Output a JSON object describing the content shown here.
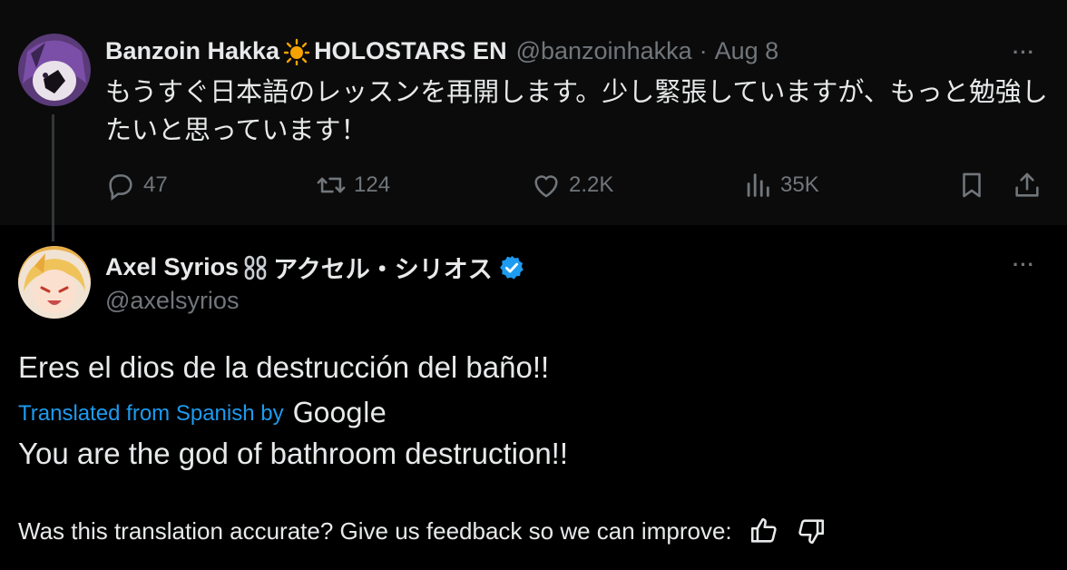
{
  "parent_tweet": {
    "author_name": "Banzoin Hakka",
    "name_emoji": "☀",
    "org": "HOLOSTARS EN",
    "handle": "@banzoinhakka",
    "separator": "·",
    "date": "Aug 8",
    "more_label": "···",
    "text": "もうすぐ日本語のレッスンを再開します。少し緊張していますが、もっと勉強したいと思っています！",
    "replies": "47",
    "reposts": "124",
    "likes": "2.2K",
    "views": "35K"
  },
  "reply_tweet": {
    "author_name": "Axel Syrios",
    "name_emoji": "⛓",
    "name_jp": "アクセル・シリオス",
    "handle": "@axelsyrios",
    "more_label": "···",
    "original_text": "Eres el dios de la destrucción del baño!!",
    "translated_from": "Translated from Spanish by",
    "translator_brand": "Google",
    "translated_text": "You are the god of bathroom destruction!!",
    "feedback_prompt": "Was this translation accurate? Give us feedback so we can improve:"
  },
  "colors": {
    "background": "#000000",
    "parent_background": "#0b0b0b",
    "text": "#e7e9ea",
    "muted": "#71767b",
    "accent": "#1d9bf0",
    "verified": "#1d9bf0",
    "sun_emoji": "#f4a300"
  },
  "icons": [
    "reply-icon",
    "repost-icon",
    "like-icon",
    "views-icon",
    "bookmark-icon",
    "share-icon",
    "verified-badge-icon",
    "thumbs-up-icon",
    "thumbs-down-icon"
  ]
}
